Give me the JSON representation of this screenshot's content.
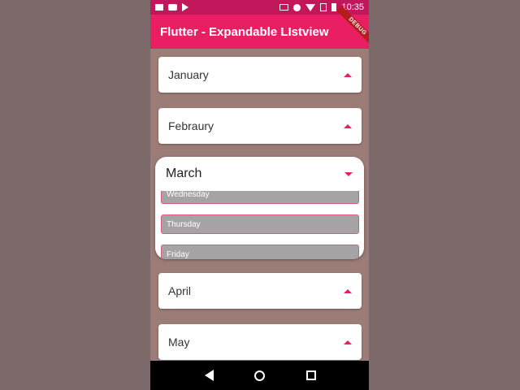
{
  "status_bar": {
    "time": "10:35",
    "icons": [
      "video-icon",
      "youtube-icon",
      "play-store-icon",
      "cast-icon",
      "do-not-disturb-icon",
      "wifi-icon",
      "no-sim-icon",
      "battery-icon"
    ]
  },
  "app_bar": {
    "title": "Flutter - Expandable LIstview",
    "debug_banner": "DEBUG"
  },
  "months": [
    {
      "label": "January",
      "expanded": false
    },
    {
      "label": "Febraury",
      "expanded": false
    },
    {
      "label": "March",
      "expanded": true,
      "days": [
        "Wednesday",
        "Thursday",
        "Friday"
      ]
    },
    {
      "label": "April",
      "expanded": false
    },
    {
      "label": "May",
      "expanded": false
    }
  ],
  "colors": {
    "status_bar": "#c2185b",
    "app_bar": "#e91e63",
    "accent": "#e91e63",
    "list_background": "#9b7c76",
    "day_tile": "#a6a3a6"
  },
  "nav_bar": {
    "icons": [
      "back-icon",
      "home-icon",
      "recents-icon"
    ]
  }
}
